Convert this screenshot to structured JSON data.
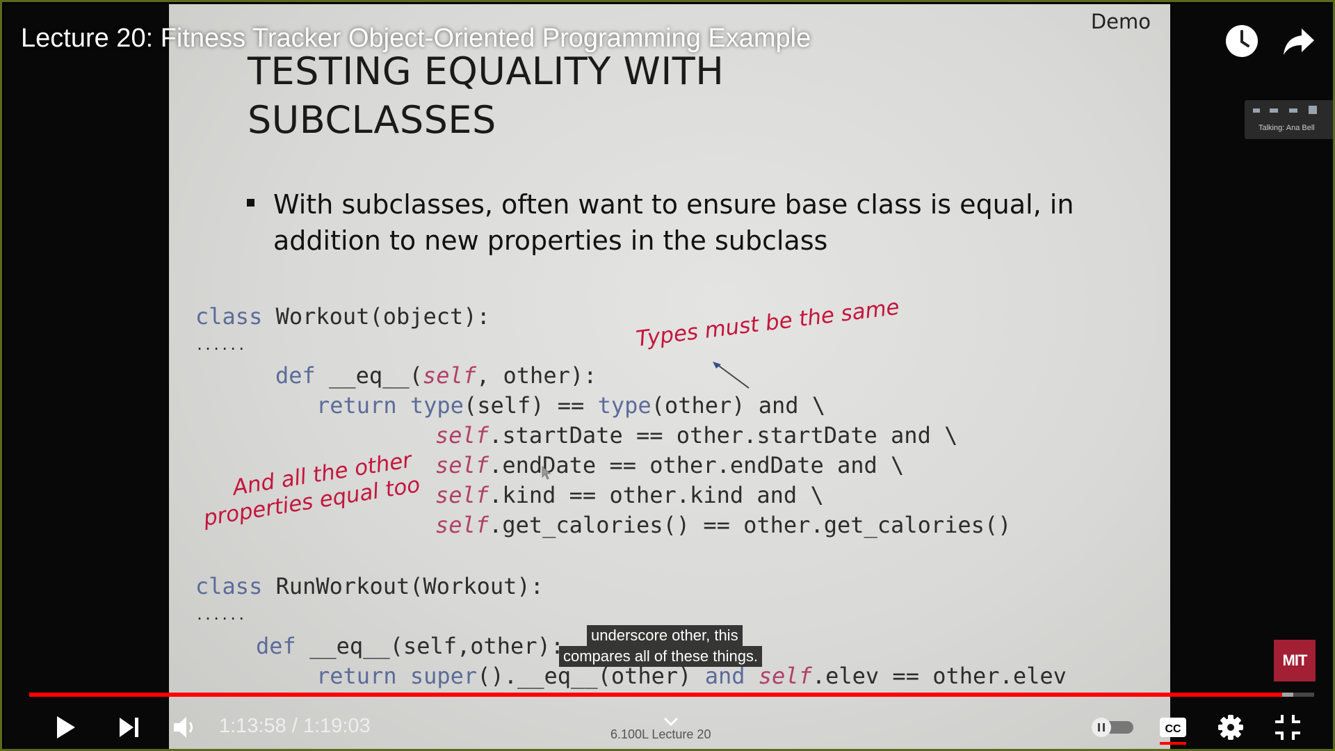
{
  "player": {
    "video_title": "Lecture 20: Fitness Tracker Object-Oriented Programming Example",
    "progress_percent": 97.5,
    "buffered_percent": 98.4,
    "time_current": "1:13:58",
    "time_separator": " / ",
    "time_total": "1:19:03",
    "captions": [
      "underscore other, this",
      "compares all of these things."
    ],
    "chapter_hint": "6.100L Lecture 20",
    "zoom_overlay_text": "Talking: Ana Bell",
    "mit_logo_text": "MIT",
    "colors": {
      "progress": "#ff0000",
      "mit_red": "#a31f34",
      "annotation_red": "#c4153b"
    },
    "icons": [
      "clock-icon",
      "share-icon",
      "play-icon",
      "next-icon",
      "volume-icon",
      "chevron-down-icon",
      "autoplay-toggle",
      "cc-icon",
      "settings-gear-icon",
      "exit-fullscreen-icon"
    ]
  },
  "slide": {
    "demo_label": "Demo",
    "title_line1": "TESTING EQUALITY WITH",
    "title_line2": "SUBCLASSES",
    "bullet_line1": "With subclasses, often want to ensure base class is equal, in",
    "bullet_line2": "addition to new properties in the subclass",
    "code": {
      "l1_kw": "class",
      "l1_rest": " Workout(object):",
      "l2": "......",
      "l3_kw": "def",
      "l3_a": " __eq__(",
      "l3_self": "self",
      "l3_b": ", other):",
      "l4_ret": "return",
      "l4_sp": " ",
      "l4_type1": "type",
      "l4_a": "(self) == ",
      "l4_type2": "type",
      "l4_b": "(other) and \\",
      "l5_self": "self",
      "l5_rest": ".startDate == other.startDate and \\",
      "l6_self": "self",
      "l6_rest": ".endDate == other.endDate and \\",
      "l7_self": "self",
      "l7_rest": ".kind == other.kind and \\",
      "l8_self": "self",
      "l8_rest": ".get_calories() == other.get_calories()",
      "l9_kw": "class",
      "l9_rest": " RunWorkout(Workout):",
      "l10": "......",
      "l11_kw": "def",
      "l11_rest": " __eq__(self,other):",
      "l12_ret": "return",
      "l12_sp": " ",
      "l12_super": "super",
      "l12_a": "().__eq__(other) ",
      "l12_and": "and",
      "l12_sp2": " ",
      "l12_self": "self",
      "l12_b": ".elev == other.elev"
    },
    "annotation_types": "Types must be the same",
    "annotation_props_1": "And all the other",
    "annotation_props_2": "properties equal too"
  }
}
